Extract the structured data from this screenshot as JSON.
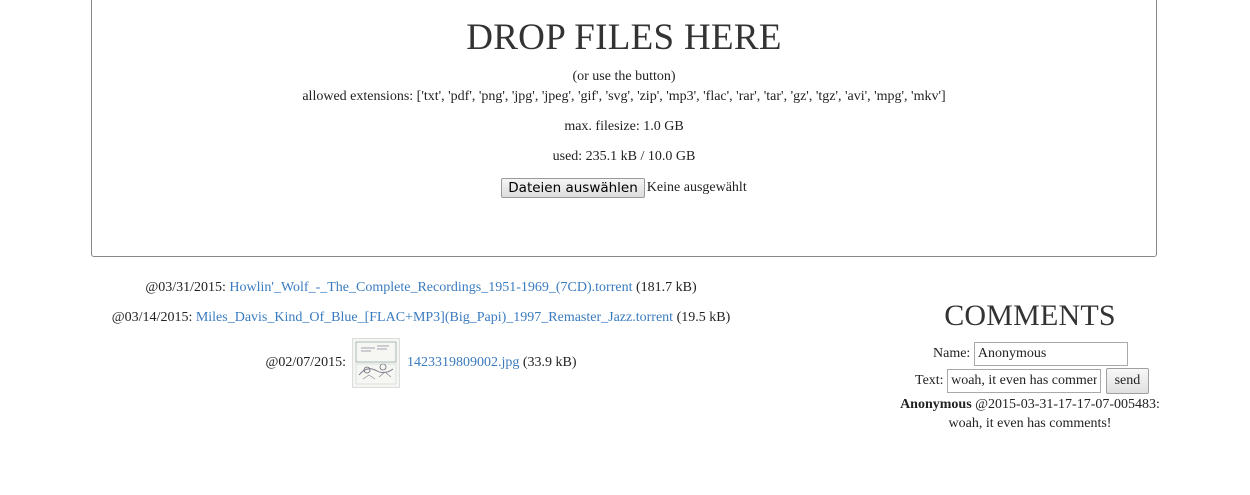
{
  "dropzone": {
    "title": "DROP FILES HERE",
    "hint": "(or use the button)",
    "extensions": "allowed extensions: ['txt', 'pdf', 'png', 'jpg', 'jpeg', 'gif', 'svg', 'zip', 'mp3', 'flac', 'rar', 'tar', 'gz', 'tgz', 'avi', 'mpg', 'mkv']",
    "max_filesize": "max. filesize: 1.0 GB",
    "used": "used: 235.1 kB / 10.0 GB",
    "file_button_label": "Dateien auswählen",
    "file_status": "Keine ausgewählt"
  },
  "files": [
    {
      "date": "@03/31/2015:",
      "name": "Howlin'_Wolf_-_The_Complete_Recordings_1951-1969_(7CD).torrent",
      "size": "(181.7 kB)"
    },
    {
      "date": "@03/14/2015:",
      "name": "Miles_Davis_Kind_Of_Blue_[FLAC+MP3](Big_Papi)_1997_Remaster_Jazz.torrent",
      "size": "(19.5 kB)"
    },
    {
      "date": "@02/07/2015:",
      "name": "1423319809002.jpg",
      "size": "(33.9 kB)",
      "thumbnail": "comic-strip-thumbnail"
    }
  ],
  "comments": {
    "title": "COMMENTS",
    "name_label": "Name:",
    "name_value": "Anonymous",
    "text_label": "Text:",
    "text_value": "woah, it even has comments!",
    "send_label": "send",
    "entries": [
      {
        "author": "Anonymous",
        "timestamp": "@2015-03-31-17-17-07-005483:",
        "text": "woah, it even has comments!"
      }
    ]
  },
  "colors": {
    "link": "#3a7bbf",
    "border": "#888888",
    "text": "#222222"
  }
}
